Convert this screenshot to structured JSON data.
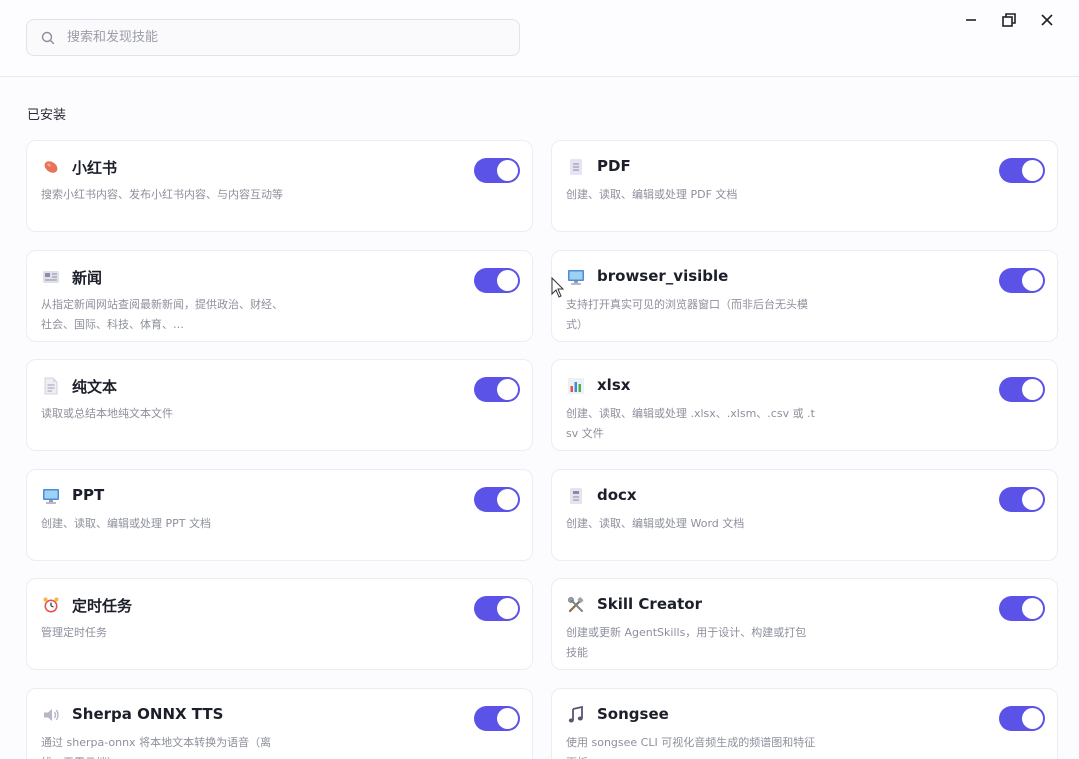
{
  "search": {
    "placeholder": "搜索和发现技能"
  },
  "section": {
    "installed_title": "已安装"
  },
  "skills": [
    {
      "icon": "sweet-potato-icon",
      "title": "小红书",
      "desc": "搜索小红书内容、发布小红书内容、与内容互动等",
      "enabled": true
    },
    {
      "icon": "document-icon",
      "title": "PDF",
      "desc": "创建、读取、编辑或处理 PDF 文档",
      "enabled": true
    },
    {
      "icon": "newspaper-icon",
      "title": "新闻",
      "desc": "从指定新闻网站查阅最新新闻，提供政治、财经、社会、国际、科技、体育、…",
      "enabled": true
    },
    {
      "icon": "monitor-icon",
      "title": "browser_visible",
      "desc": "支持打开真实可见的浏览器窗口（而非后台无头模式）",
      "enabled": true
    },
    {
      "icon": "text-file-icon",
      "title": "纯文本",
      "desc": "读取或总结本地纯文本文件",
      "enabled": true
    },
    {
      "icon": "bar-chart-icon",
      "title": "xlsx",
      "desc": "创建、读取、编辑或处理 .xlsx、.xlsm、.csv 或 .tsv 文件",
      "enabled": true
    },
    {
      "icon": "monitor-icon",
      "title": "PPT",
      "desc": "创建、读取、编辑或处理 PPT 文档",
      "enabled": true
    },
    {
      "icon": "word-doc-icon",
      "title": "docx",
      "desc": "创建、读取、编辑或处理 Word 文档",
      "enabled": true
    },
    {
      "icon": "alarm-clock-icon",
      "title": "定时任务",
      "desc": "管理定时任务",
      "enabled": true
    },
    {
      "icon": "tools-icon",
      "title": "Skill Creator",
      "desc": "创建或更新 AgentSkills，用于设计、构建或打包技能",
      "enabled": true
    },
    {
      "icon": "speaker-icon",
      "title": "Sherpa ONNX TTS",
      "desc": "通过 sherpa-onnx 将本地文本转换为语音（离线，无需云端）",
      "enabled": true
    },
    {
      "icon": "music-note-icon",
      "title": "Songsee",
      "desc": "使用 songsee CLI 可视化音频生成的频谱图和特征面板",
      "enabled": true
    }
  ],
  "colors": {
    "accent": "#5b52e8",
    "background": "#fcfcfe",
    "card_border": "#ececf3"
  }
}
